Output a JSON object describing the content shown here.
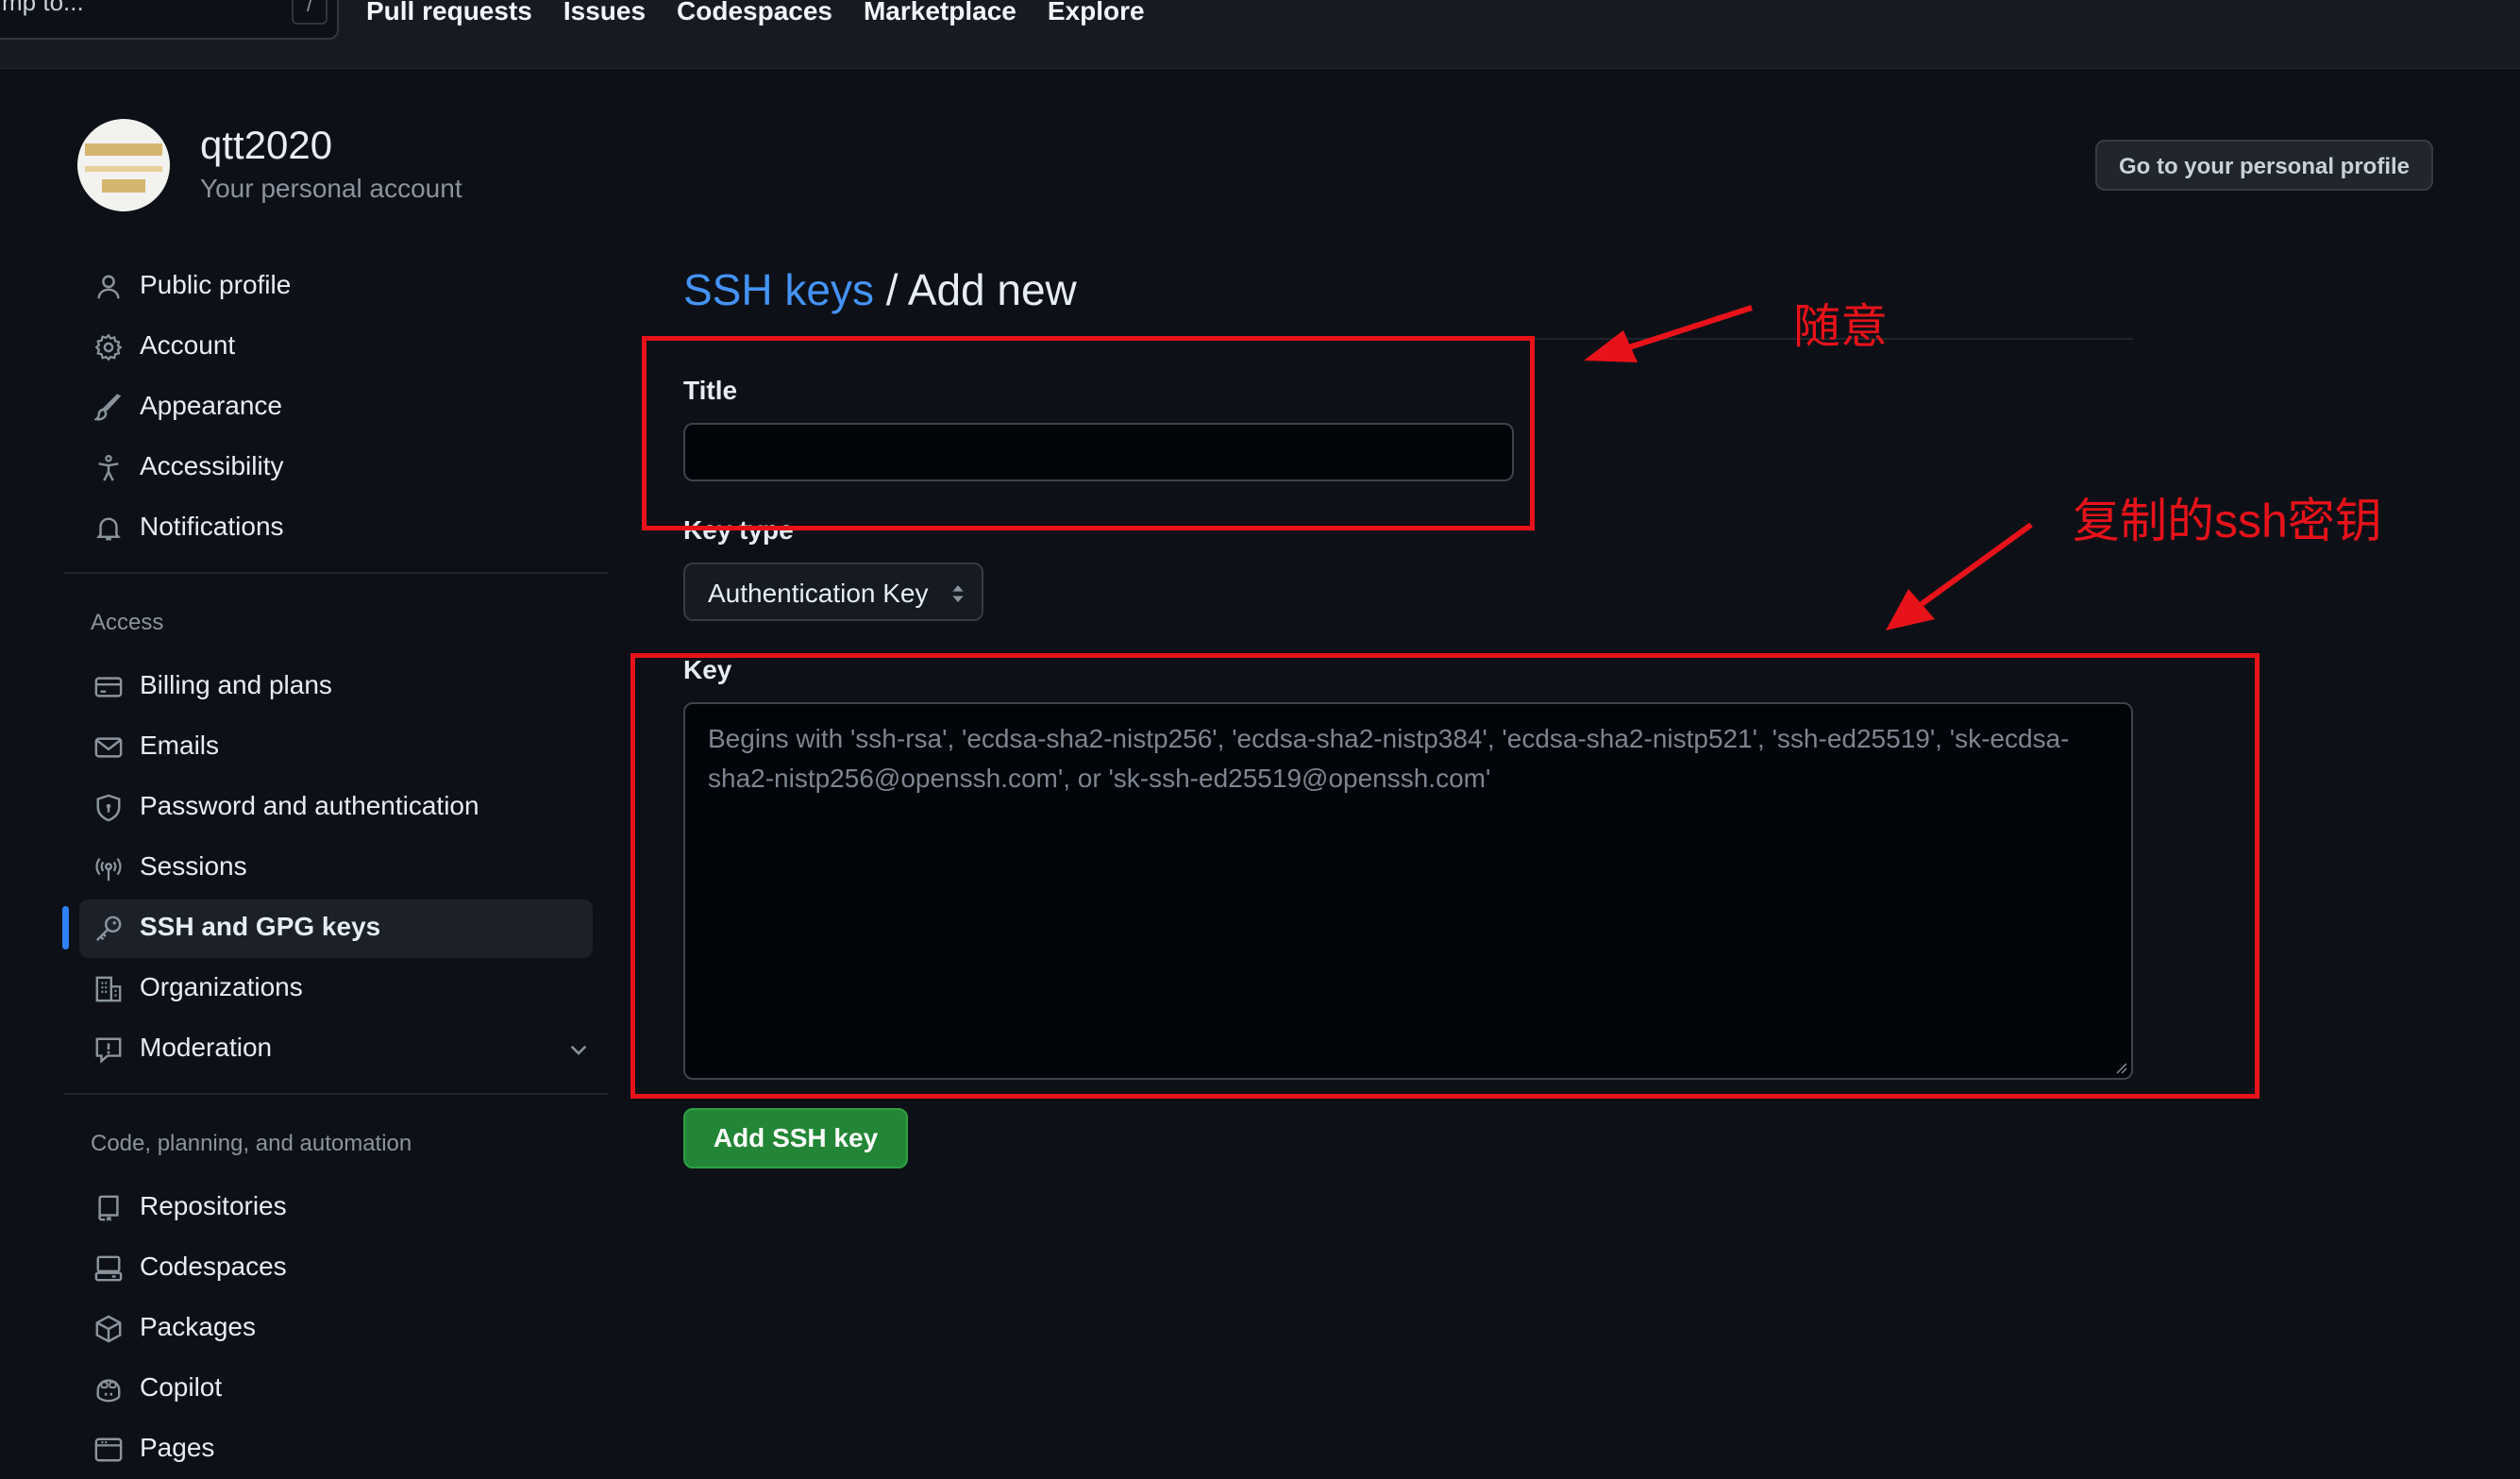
{
  "header": {
    "search_text": "mp to...",
    "search_shortcut": "/",
    "nav": [
      "Pull requests",
      "Issues",
      "Codespaces",
      "Marketplace",
      "Explore"
    ]
  },
  "account": {
    "name": "qtt2020",
    "subtitle": "Your personal account",
    "profile_button": "Go to your personal profile"
  },
  "sidebar": {
    "top_items": [
      {
        "label": "Public profile",
        "icon": "person-icon"
      },
      {
        "label": "Account",
        "icon": "gear-icon"
      },
      {
        "label": "Appearance",
        "icon": "paintbrush-icon"
      },
      {
        "label": "Accessibility",
        "icon": "accessibility-icon"
      },
      {
        "label": "Notifications",
        "icon": "bell-icon"
      }
    ],
    "access_heading": "Access",
    "access_items": [
      {
        "label": "Billing and plans",
        "icon": "credit-card-icon"
      },
      {
        "label": "Emails",
        "icon": "mail-icon"
      },
      {
        "label": "Password and authentication",
        "icon": "shield-icon"
      },
      {
        "label": "Sessions",
        "icon": "broadcast-icon"
      },
      {
        "label": "SSH and GPG keys",
        "icon": "key-icon",
        "active": true
      },
      {
        "label": "Organizations",
        "icon": "organization-icon"
      },
      {
        "label": "Moderation",
        "icon": "report-icon"
      }
    ],
    "code_heading": "Code, planning, and automation",
    "code_items": [
      {
        "label": "Repositories",
        "icon": "repo-icon"
      },
      {
        "label": "Codespaces",
        "icon": "codespaces-icon"
      },
      {
        "label": "Packages",
        "icon": "package-icon"
      },
      {
        "label": "Copilot",
        "icon": "copilot-icon"
      },
      {
        "label": "Pages",
        "icon": "browser-icon"
      }
    ]
  },
  "main": {
    "breadcrumb_link": "SSH keys",
    "breadcrumb_separator": " / ",
    "breadcrumb_current": "Add new",
    "title_label": "Title",
    "title_value": "",
    "key_type_label": "Key type",
    "key_type_value": "Authentication Key",
    "key_label": "Key",
    "key_placeholder": "Begins with 'ssh-rsa', 'ecdsa-sha2-nistp256', 'ecdsa-sha2-nistp384', 'ecdsa-sha2-nistp521', 'ssh-ed25519', 'sk-ecdsa-sha2-nistp256@openssh.com', or 'sk-ssh-ed25519@openssh.com'",
    "submit_label": "Add SSH key"
  },
  "annotations": {
    "title_note": "随意",
    "key_note": "复制的ssh密钥",
    "color": "#e8121a"
  },
  "colors": {
    "background": "#0d1117",
    "link": "#4493f8",
    "primary_button": "#238636",
    "active_marker": "#2f81f7"
  }
}
